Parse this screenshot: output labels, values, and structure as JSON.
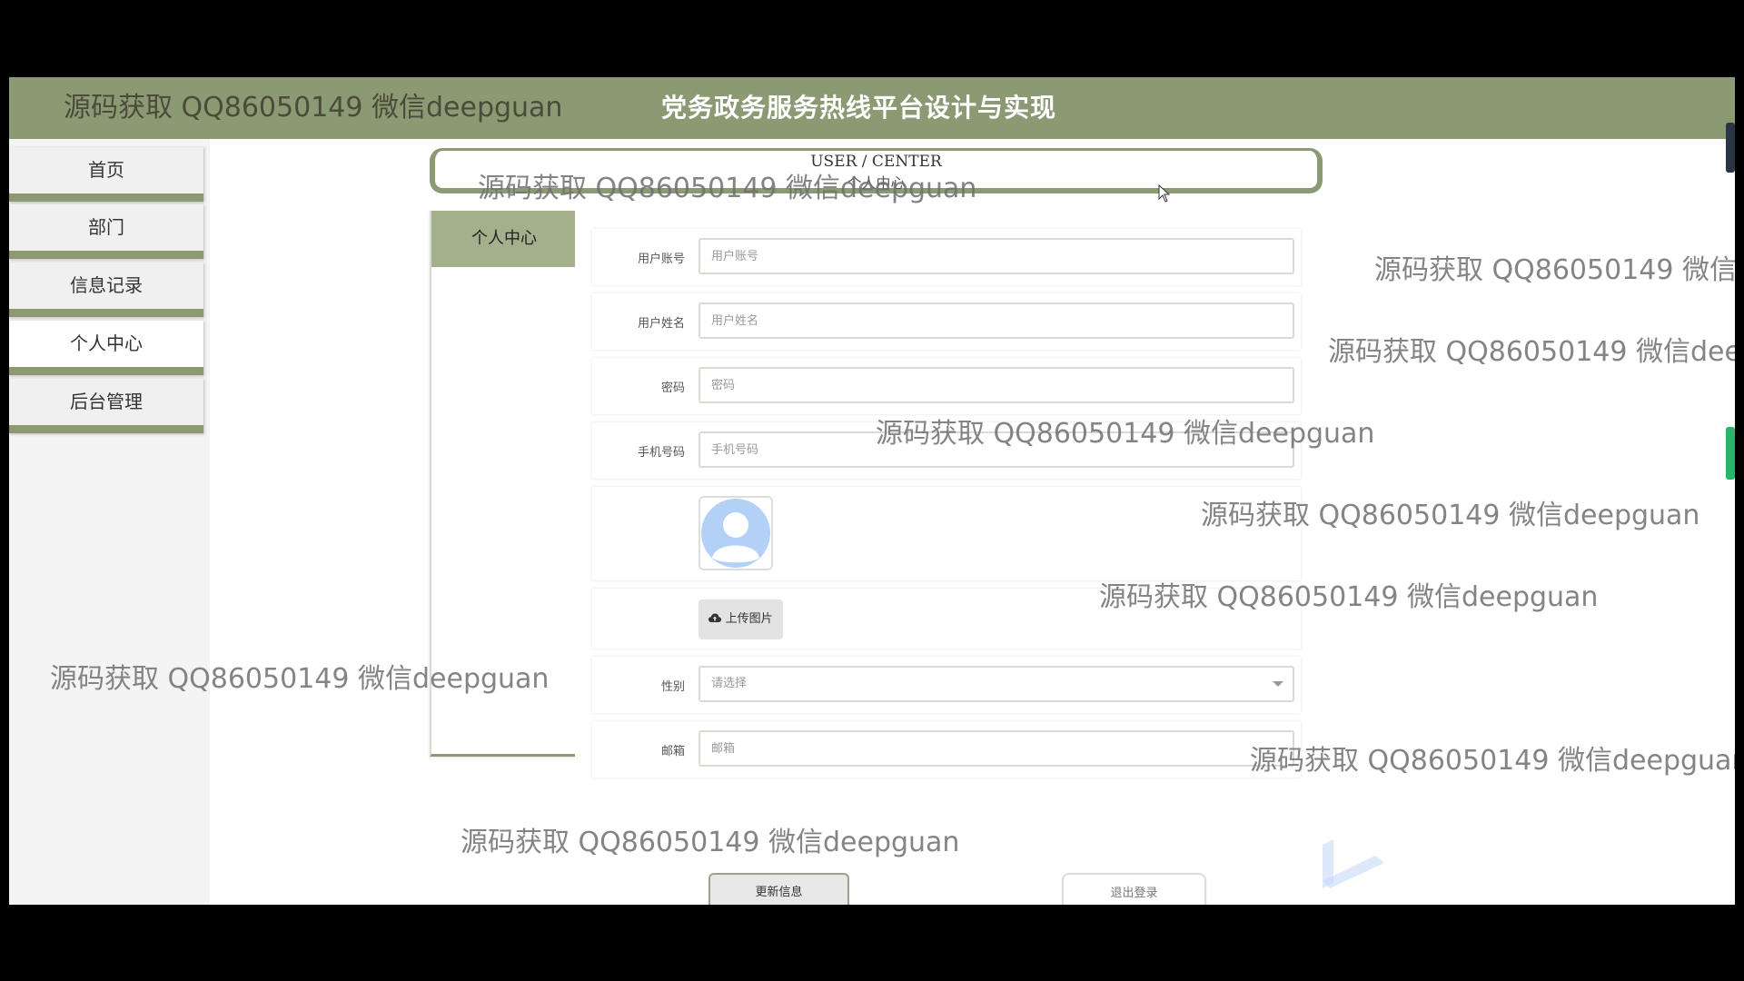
{
  "header": {
    "title": "党务政务服务热线平台设计与实现"
  },
  "sidebar": {
    "items": [
      {
        "label": "首页"
      },
      {
        "label": "部门"
      },
      {
        "label": "信息记录"
      },
      {
        "label": "个人中心",
        "active": true
      },
      {
        "label": "后台管理"
      }
    ]
  },
  "banner": {
    "en": "USER / CENTER",
    "cn": "个人中心"
  },
  "tab": {
    "label": "个人中心"
  },
  "form": {
    "account": {
      "label": "用户账号",
      "placeholder": "用户账号"
    },
    "name": {
      "label": "用户姓名",
      "placeholder": "用户姓名"
    },
    "password": {
      "label": "密码",
      "placeholder": "密码"
    },
    "phone": {
      "label": "手机号码",
      "placeholder": "手机号码"
    },
    "upload_label": "上传图片",
    "gender": {
      "label": "性别",
      "placeholder": "请选择"
    },
    "email": {
      "label": "邮箱",
      "placeholder": "邮箱"
    },
    "update_label": "更新信息",
    "logout_label": "退出登录"
  },
  "watermark": {
    "text": "源码获取 QQ86050149 微信deepguan"
  },
  "icons": {
    "avatar": "user-avatar-icon",
    "upload": "cloud-upload-icon",
    "select": "chevron-down-icon",
    "cursor": "mouse-cursor-icon"
  },
  "colors": {
    "header": "#8c9a73",
    "tab_active": "#a4af8c",
    "avatar": "#b3d1f7"
  }
}
